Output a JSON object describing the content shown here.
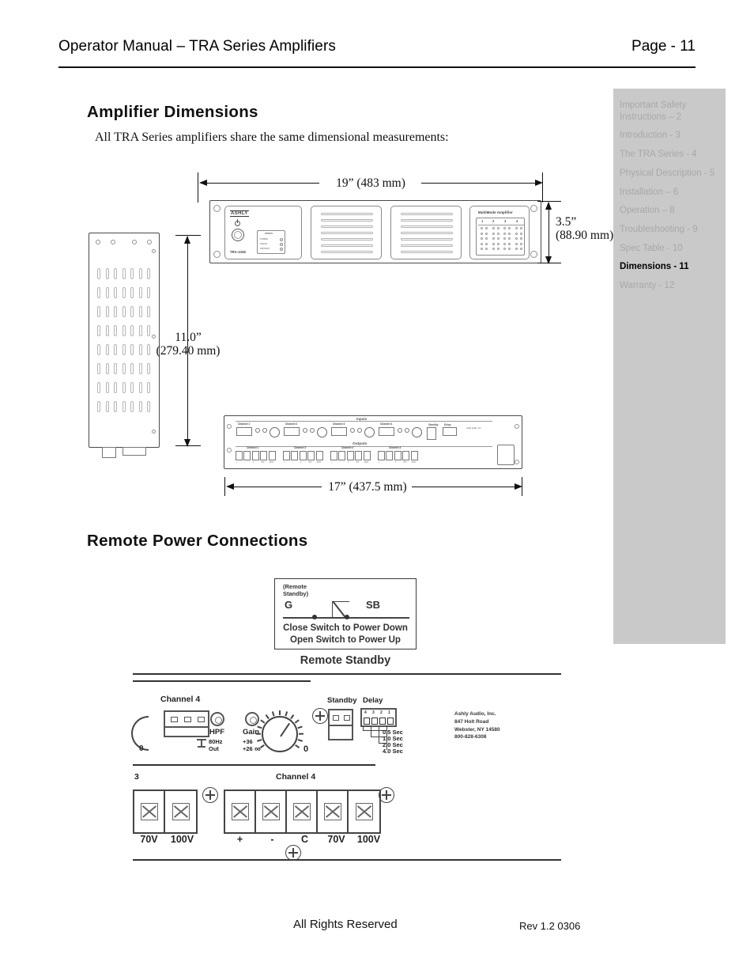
{
  "header": {
    "title": "Operator Manual – TRA Series Amplifiers",
    "page_label": "Page - 11"
  },
  "sidebar": {
    "items": [
      {
        "label": "Important Safety Instructions – 2",
        "active": false
      },
      {
        "label": "Introduction - 3",
        "active": false
      },
      {
        "label": "The TRA Series - 4",
        "active": false
      },
      {
        "label": "Physical Description - 5",
        "active": false
      },
      {
        "label": "Installation – 6",
        "active": false
      },
      {
        "label": "Operation – 8",
        "active": false
      },
      {
        "label": "Troubleshooting - 9",
        "active": false
      },
      {
        "label": "Spec Table - 10",
        "active": false
      },
      {
        "label": "Dimensions - 11",
        "active": true
      },
      {
        "label": "Warranty - 12",
        "active": false
      }
    ],
    "background_color": "#c9c9c9",
    "inactive_color": "#a8a8a8",
    "active_color": "#000000"
  },
  "sections": {
    "dimensions": {
      "heading": "Amplifier Dimensions",
      "intro": "All TRA Series amplifiers share the same dimensional measurements:",
      "callouts": {
        "width_front": "19” (483 mm)",
        "height_front": "3.5”\n(88.90 mm)",
        "height_front_l1": "3.5”",
        "height_front_l2": "(88.90 mm)",
        "depth_l1": "11.0”",
        "depth_l2": "(279.40 mm)",
        "width_rear": "17” (437.5 mm)"
      }
    },
    "remote": {
      "heading": "Remote Power Connections"
    }
  },
  "front_panel": {
    "brand": "ASHLY",
    "model": "TRA-4150",
    "power_icon": "power-icon",
    "led_legend_title": "STATUS",
    "led_legend": [
      "POWER",
      "SIGNAL",
      "PROTECT"
    ],
    "multimode_title": "MultiMode Amplifier",
    "channel_numbers": [
      "1",
      "2",
      "3",
      "4"
    ]
  },
  "rear_panel": {
    "inputs_label": "Inputs",
    "outputs_label": "Outputs",
    "input_channels": [
      "Channel 1",
      "Channel 2",
      "Channel 3",
      "Channel 4"
    ],
    "output_channels": [
      "Channel 1",
      "Channel 2",
      "Channel 3",
      "Channel 4"
    ],
    "output_terminals": [
      "+",
      "-",
      "C",
      "70V",
      "100V"
    ],
    "standby_label": "Standby",
    "delay_label": "Delay",
    "company": "Ashly Audio, Inc."
  },
  "remote_standby": {
    "terminal_note_l1": "(Remote",
    "terminal_note_l2": "Standby)",
    "terminal_g": "G",
    "terminal_sb": "SB",
    "instruction_l1": "Close Switch to Power Down",
    "instruction_l2": "Open Switch to Power Up",
    "caption": "Remote Standby"
  },
  "detail_diagram": {
    "channel_label": "Channel 4",
    "hpf_label": "HPF",
    "hpf_opt_l1": "80Hz",
    "hpf_opt_l2": "Out",
    "gain_label": "Gain",
    "gain_opt_l1": "+36",
    "gain_opt_l2": "+26",
    "knob_min": "∞",
    "knob_max": "0",
    "left_knob_max": "0",
    "standby_label": "Standby",
    "delay_label": "Delay",
    "dip_numbers": [
      "4",
      "3",
      "2",
      "1"
    ],
    "delay_options": [
      "0.5 Sec",
      "1.0 Sec",
      "2.0 Sec",
      "4.0 Sec"
    ],
    "company": {
      "name": "Ashly Audio, Inc.",
      "street": "847 Holt Road",
      "city": "Webster, NY 14580",
      "phone": "800-828-6308"
    }
  },
  "terminal_strip": {
    "left_group_number": "3",
    "left_group_labels": [
      "70V",
      "100V"
    ],
    "right_group_label": "Channel 4",
    "right_group_labels": [
      "+",
      "-",
      "C",
      "70V",
      "100V"
    ]
  },
  "footer": {
    "left": "All Rights Reserved",
    "right": "Rev 1.2 0306"
  }
}
